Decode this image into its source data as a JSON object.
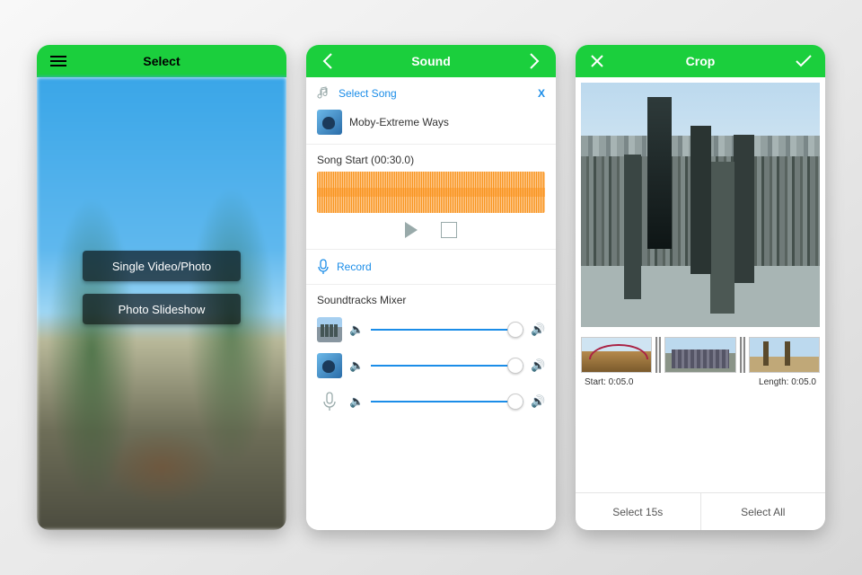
{
  "colors": {
    "accent": "#1bcf3d",
    "link": "#1b8de8",
    "wave": "#f7941d"
  },
  "select": {
    "title": "Select",
    "single_btn": "Single Video/Photo",
    "slideshow_btn": "Photo Slideshow"
  },
  "sound": {
    "title": "Sound",
    "select_song": "Select Song",
    "close_x": "X",
    "current_song": "Moby-Extreme Ways",
    "song_start_label": "Song Start (00:30.0)",
    "record": "Record",
    "mixer_label": "Soundtracks Mixer",
    "tracks": [
      {
        "icon": "city-thumb",
        "level": 1.0
      },
      {
        "icon": "album-thumb",
        "level": 1.0
      },
      {
        "icon": "mic-icon",
        "level": 1.0
      }
    ]
  },
  "crop": {
    "title": "Crop",
    "start_label": "Start: 0:05.0",
    "length_label": "Length: 0:05.0",
    "select15": "Select 15s",
    "select_all": "Select All"
  }
}
